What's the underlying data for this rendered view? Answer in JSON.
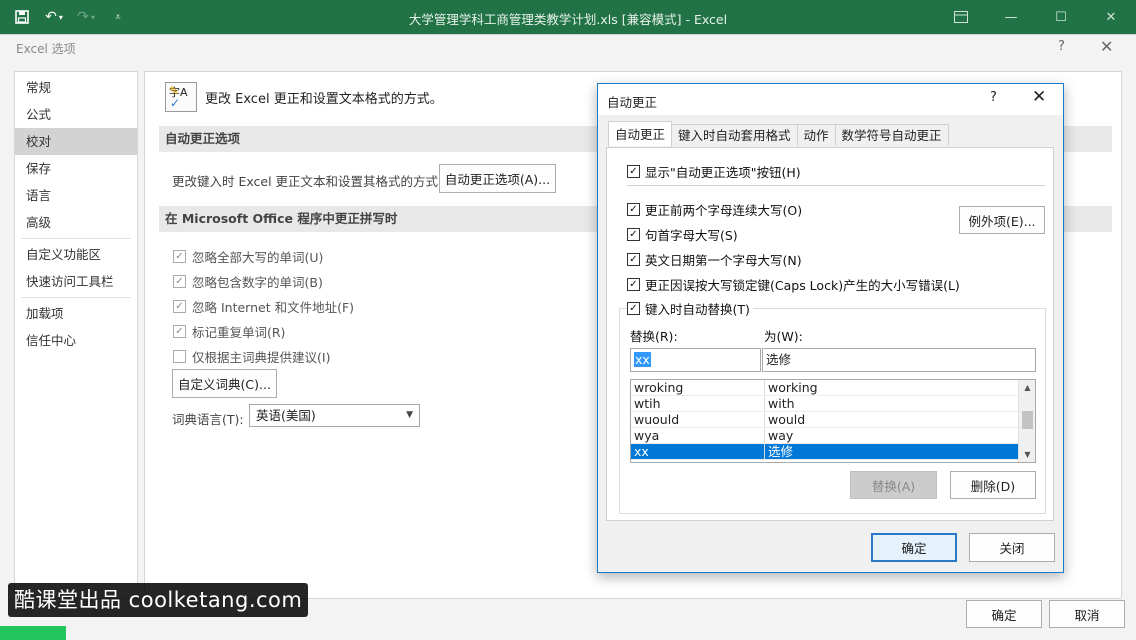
{
  "window": {
    "title": "大学管理学科工商管理类教学计划.xls  [兼容模式] - Excel",
    "qat": {
      "save_icon": "save-icon",
      "undo_icon": "undo-icon",
      "redo_icon": "redo-icon",
      "customize_icon": "customize-qat-icon"
    },
    "controls": {
      "ribbon_icon": "ribbon-display-icon",
      "minimize": "—",
      "maximize": "☐",
      "close": "✕"
    }
  },
  "options_dialog": {
    "title": "Excel 选项",
    "help": "?",
    "close": "✕",
    "nav": [
      "常规",
      "公式",
      "校对",
      "保存",
      "语言",
      "高级",
      "自定义功能区",
      "快速访问工具栏",
      "加载项",
      "信任中心"
    ],
    "active_nav": "校对",
    "header_text": "更改 Excel 更正和设置文本格式的方式。",
    "section1_title": "自动更正选项",
    "section1_desc": "更改键入时 Excel 更正文本和设置其格式的方式:",
    "autocorrect_button": "自动更正选项(A)...",
    "section2_title": "在 Microsoft Office 程序中更正拼写时",
    "spelling_options": [
      {
        "label": "忽略全部大写的单词(U)",
        "checked": true
      },
      {
        "label": "忽略包含数字的单词(B)",
        "checked": true
      },
      {
        "label": "忽略 Internet 和文件地址(F)",
        "checked": true
      },
      {
        "label": "标记重复单词(R)",
        "checked": true
      },
      {
        "label": "仅根据主词典提供建议(I)",
        "checked": false
      }
    ],
    "custom_dict_button": "自定义词典(C)...",
    "dict_lang_label": "词典语言(T):",
    "dict_lang_value": "英语(美国)",
    "ok": "确定",
    "cancel": "取消"
  },
  "autocorrect_dialog": {
    "title": "自动更正",
    "help": "?",
    "close": "✕",
    "tabs": [
      "自动更正",
      "键入时自动套用格式",
      "动作",
      "数学符号自动更正"
    ],
    "active_tab": "自动更正",
    "show_buttons": {
      "label": "显示\"自动更正选项\"按钮(H)",
      "checked": true
    },
    "options": [
      {
        "label": "更正前两个字母连续大写(O)",
        "checked": true
      },
      {
        "label": "句首字母大写(S)",
        "checked": true
      },
      {
        "label": "英文日期第一个字母大写(N)",
        "checked": true
      },
      {
        "label": "更正因误按大写锁定键(Caps Lock)产生的大小写错误(L)",
        "checked": true
      },
      {
        "label": "键入时自动替换(T)",
        "checked": true
      }
    ],
    "exceptions_button": "例外项(E)...",
    "replace_label": "替换(R):",
    "with_label": "为(W):",
    "replace_value": "xx",
    "with_value": "选修",
    "list": [
      {
        "replace": "wroking",
        "with": "working"
      },
      {
        "replace": "wtih",
        "with": "with"
      },
      {
        "replace": "wuould",
        "with": "would"
      },
      {
        "replace": "wya",
        "with": "way"
      },
      {
        "replace": "xx",
        "with": "选修",
        "selected": true
      }
    ],
    "replace_button": "替换(A)",
    "delete_button": "删除(D)",
    "ok": "确定",
    "close_button": "关闭"
  },
  "watermark": "酷课堂出品 coolketang.com"
}
